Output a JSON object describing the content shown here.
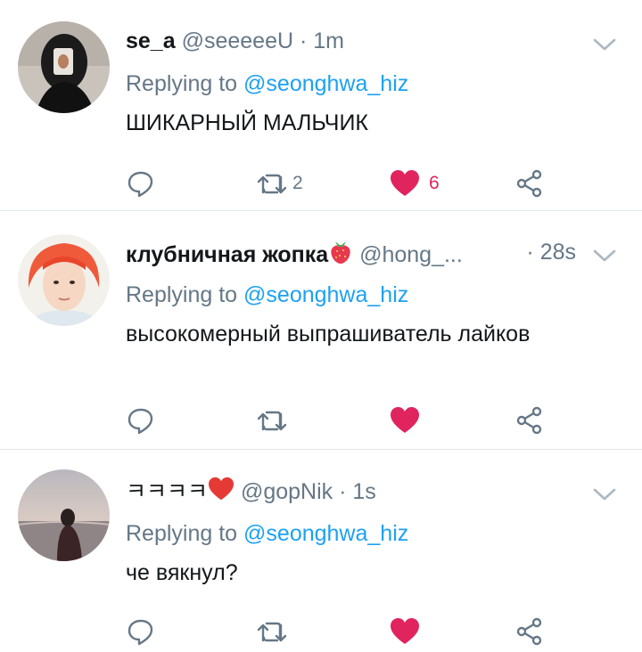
{
  "tweets": [
    {
      "name": "se_a",
      "handle": "@seeeeeU",
      "sep": " · ",
      "time": "1m",
      "reply_prefix": "Replying to ",
      "reply_to": "@seonghwa_hiz",
      "text": "ШИКАРНЫЙ МАЛЬЧИК",
      "retweets": "2",
      "likes": "6",
      "liked": true
    },
    {
      "name": "клубничная жопка",
      "handle": "@hong_...",
      "sep": " · ",
      "time": "28s",
      "reply_prefix": "Replying to ",
      "reply_to": "@seonghwa_hiz",
      "text": "высокомерный выпрашиватель лайков",
      "retweets": "",
      "likes": "",
      "liked": true
    },
    {
      "name": "ㅋㅋㅋㅋ",
      "handle": "@gopNik",
      "sep": " · ",
      "time": "1s",
      "reply_prefix": "Replying to ",
      "reply_to": "@seonghwa_hiz",
      "text": "че вякнул?",
      "retweets": "",
      "likes": "",
      "liked": true
    }
  ],
  "icons": {
    "reply": "reply-icon",
    "retweet": "retweet-icon",
    "like": "heart-icon",
    "share": "share-icon",
    "more": "chevron-down-icon"
  },
  "colors": {
    "like": "#e0245e",
    "link": "#1da1f2",
    "muted": "#657786",
    "text": "#14171a",
    "divider": "#e1e8ed"
  }
}
